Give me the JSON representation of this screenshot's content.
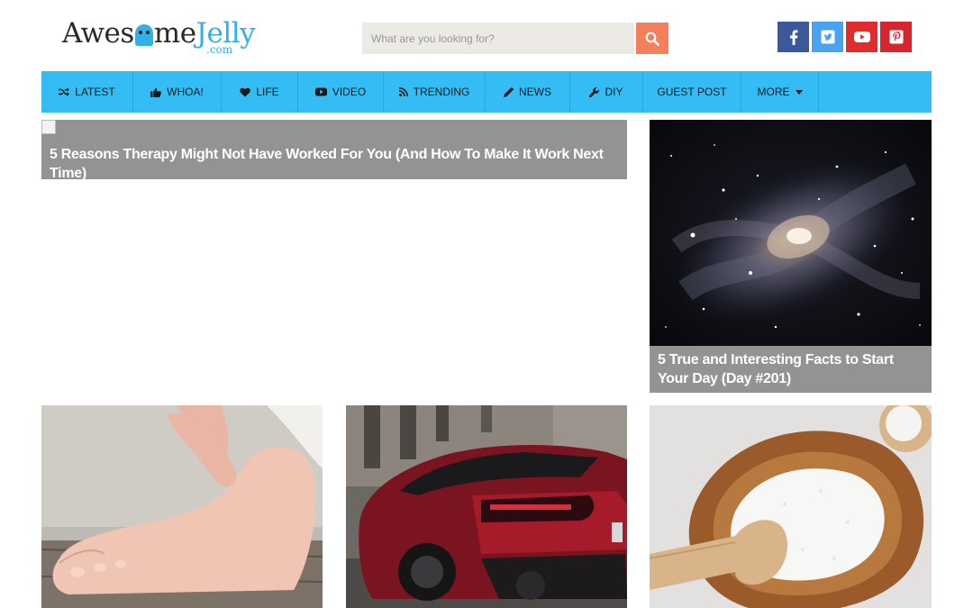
{
  "logo": {
    "part1": "Awes",
    "part2": "me",
    "part3": "Jelly",
    "com": ".com"
  },
  "search": {
    "placeholder": "What are you looking for?"
  },
  "social": [
    "facebook-icon",
    "twitter-icon",
    "youtube-icon",
    "pinterest-icon"
  ],
  "nav": {
    "items": [
      {
        "label": "LATEST",
        "icon": "shuffle-icon"
      },
      {
        "label": "WHOA!",
        "icon": "thumbs-up-icon"
      },
      {
        "label": "LIFE",
        "icon": "heart-icon"
      },
      {
        "label": "VIDEO",
        "icon": "youtube-icon"
      },
      {
        "label": "TRENDING",
        "icon": "rss-icon"
      },
      {
        "label": "NEWS",
        "icon": "pencil-icon"
      },
      {
        "label": "DIY",
        "icon": "wrench-icon"
      },
      {
        "label": "GUEST POST",
        "icon": ""
      },
      {
        "label": "MORE",
        "icon": "caret-down-icon"
      }
    ]
  },
  "featured": [
    {
      "title": "5 Reasons Therapy Might Not Have Worked For You (And How To Make It Work Next Time)"
    },
    {
      "title": "5 True and Interesting Facts to Start Your Day (Day #201)"
    }
  ],
  "colors": {
    "accent": "#33bdf4",
    "search_button": "#f47f5d",
    "caption_bg": "#939393"
  }
}
